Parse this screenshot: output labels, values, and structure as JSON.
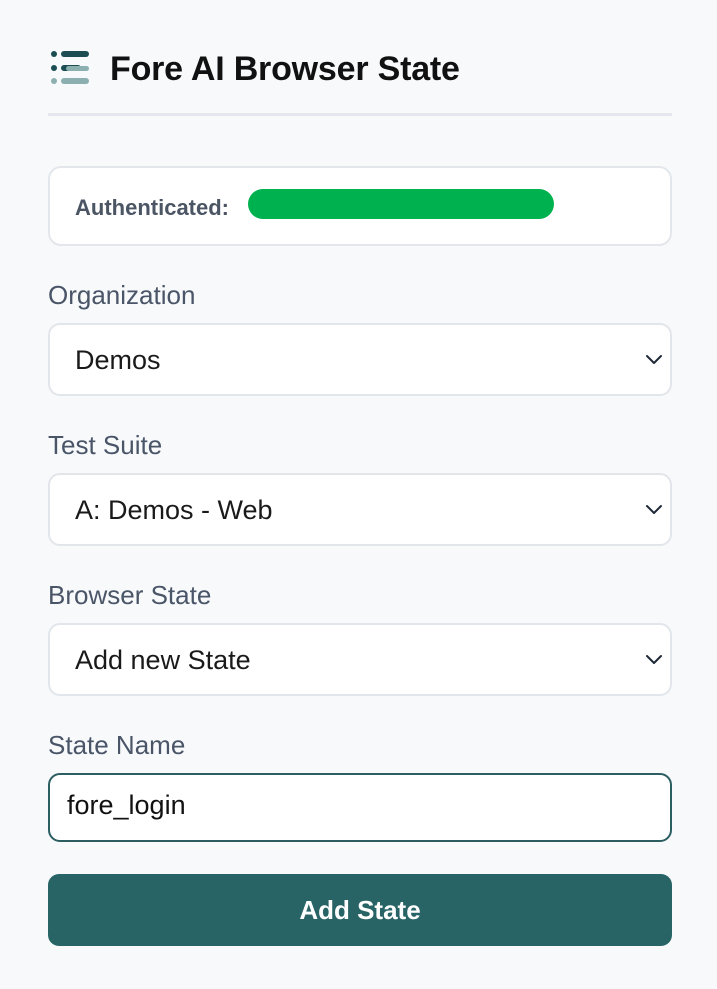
{
  "header": {
    "title": "Fore AI Browser State",
    "logo_icon": "fore-logo-icon"
  },
  "auth": {
    "label": "Authenticated:",
    "value_redacted": true,
    "redaction_color": "#00b14f"
  },
  "organization": {
    "label": "Organization",
    "selected": "Demos"
  },
  "test_suite": {
    "label": "Test Suite",
    "selected": "A: Demos - Web"
  },
  "browser_state": {
    "label": "Browser State",
    "selected": "Add new State"
  },
  "state_name": {
    "label": "State Name",
    "value": "fore_login"
  },
  "add_button": {
    "label": "Add State"
  },
  "colors": {
    "accent": "#286466",
    "logo_dark": "#1b4d52",
    "logo_light": "#8cafb0",
    "background": "#f7f9fb"
  }
}
